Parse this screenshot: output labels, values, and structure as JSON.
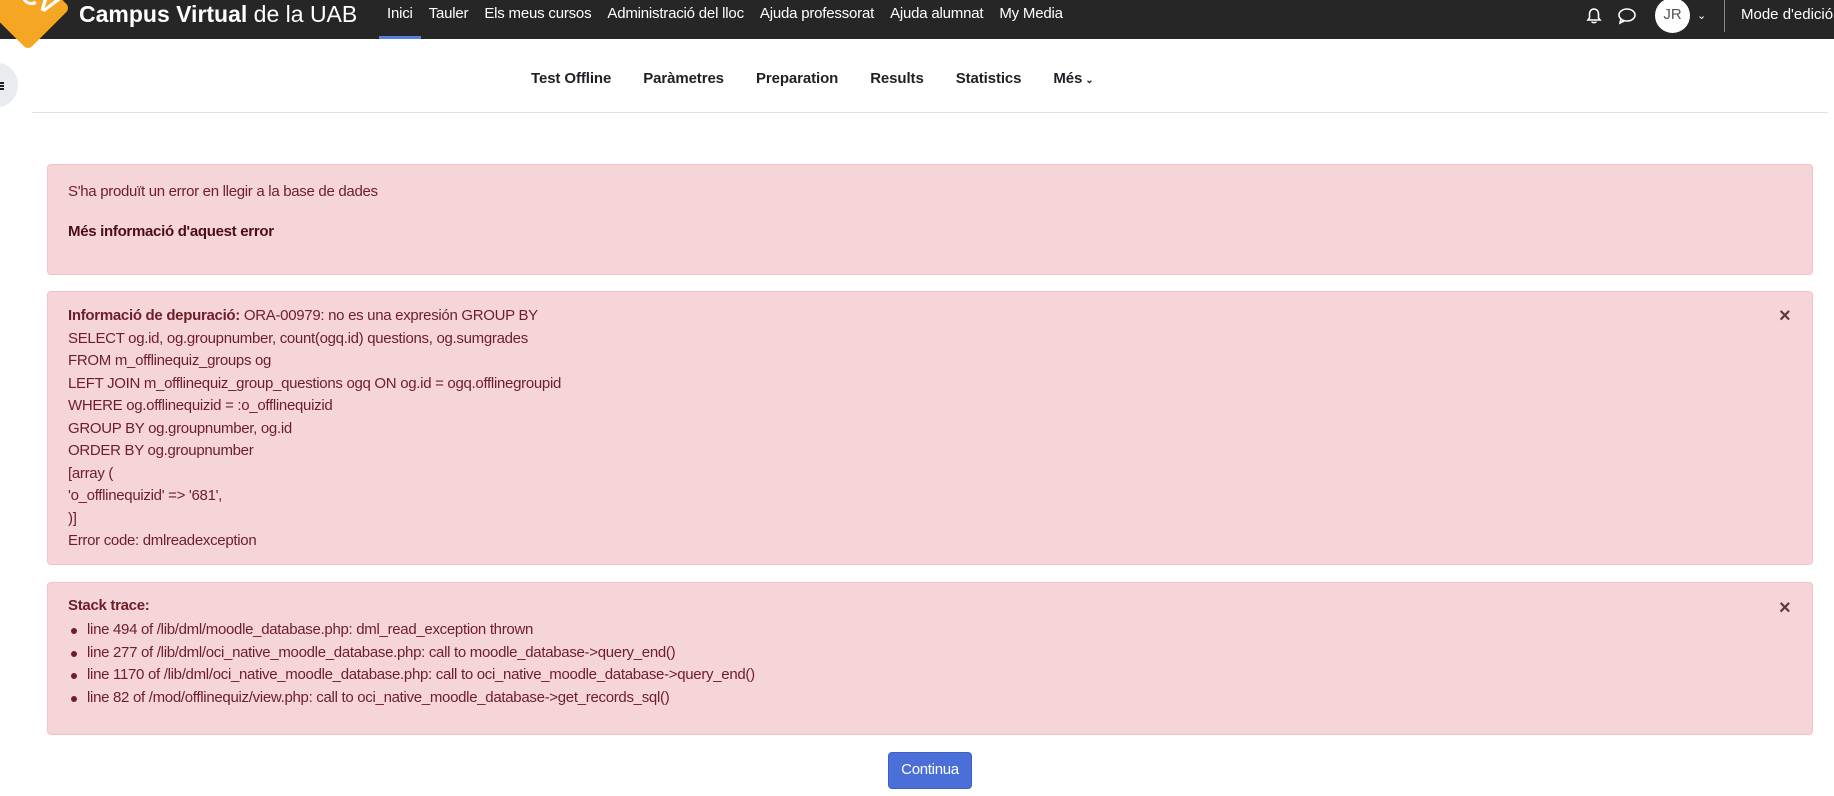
{
  "navbar": {
    "logo_text": "CV",
    "site_name_bold": "Campus Virtual",
    "site_name_rest": " de la UAB",
    "items": [
      {
        "label": "Inici",
        "active": true
      },
      {
        "label": "Tauler"
      },
      {
        "label": "Els meus cursos"
      },
      {
        "label": "Administració del lloc"
      },
      {
        "label": "Ajuda professorat"
      },
      {
        "label": "Ajuda alumnat"
      },
      {
        "label": "My Media"
      }
    ],
    "user_initials": "JR",
    "edit_mode_label": "Mode d'edició",
    "accent_color": "#5b7fe0"
  },
  "secondary_nav": {
    "items": [
      {
        "label": "Test Offline"
      },
      {
        "label": "Paràmetres"
      },
      {
        "label": "Preparation"
      },
      {
        "label": "Results"
      },
      {
        "label": "Statistics"
      },
      {
        "label": "Més"
      }
    ]
  },
  "error_alert": {
    "message": "S'ha produït un error en llegir a la base de dades",
    "more_info_link": "Més informació d'aquest error"
  },
  "debug_alert": {
    "label": "Informació de depuració:",
    "first_line": " ORA-00979: no es una expresión GROUP BY",
    "lines": [
      "SELECT og.id, og.groupnumber, count(ogq.id) questions, og.sumgrades",
      "FROM m_offlinequiz_groups og",
      "LEFT JOIN m_offlinequiz_group_questions ogq ON og.id = ogq.offlinegroupid",
      "WHERE og.offlinequizid = :o_offlinequizid",
      "GROUP BY og.groupnumber, og.id",
      "ORDER BY og.groupnumber",
      "[array (",
      "'o_offlinequizid' => '681',",
      ")]",
      "Error code: dmlreadexception"
    ]
  },
  "stack_alert": {
    "title": "Stack trace:",
    "items": [
      "line 494 of /lib/dml/moodle_database.php: dml_read_exception thrown",
      "line 277 of /lib/dml/oci_native_moodle_database.php: call to moodle_database->query_end()",
      "line 1170 of /lib/dml/oci_native_moodle_database.php: call to oci_native_moodle_database->query_end()",
      "line 82 of /mod/offlinequiz/view.php: call to oci_native_moodle_database->get_records_sql()"
    ]
  },
  "continue_button": "Continua",
  "colors": {
    "navbar_bg": "#262626",
    "alert_bg": "#f6d5d9",
    "alert_text": "#6e1d2a",
    "button_bg": "#4a6fd8"
  }
}
